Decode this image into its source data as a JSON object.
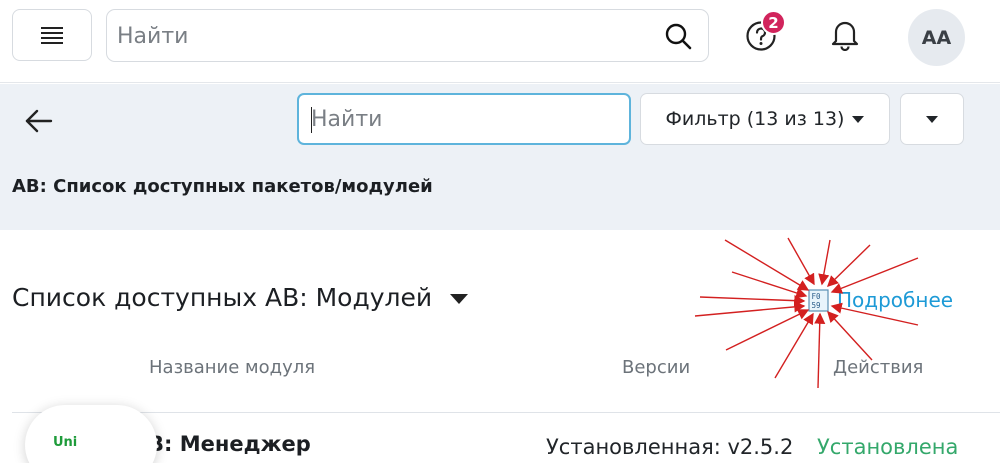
{
  "header": {
    "search_placeholder": "Найти",
    "notification_badge": "2",
    "avatar_initials": "AA"
  },
  "subheader": {
    "search_placeholder": "Найти",
    "filter_label": "Фильтр (13 из 13)",
    "breadcrumb": "АВ: Список доступных пакетов/модулей"
  },
  "list": {
    "title": "Список доступных АВ: Модулей",
    "details_link": "Подробнее",
    "columns": [
      "Название модуля",
      "Версии",
      "Действия"
    ],
    "rows": [
      {
        "name": "В: Менеджер",
        "version": "Установленная: v2.5.2",
        "status": "Установлена"
      }
    ]
  },
  "widget": {
    "label": "Uni"
  },
  "colors": {
    "accent": "#1d9ad6",
    "status_ok": "#34a86b",
    "badge": "#d1245c",
    "annotation_arrows": "#d32020"
  }
}
